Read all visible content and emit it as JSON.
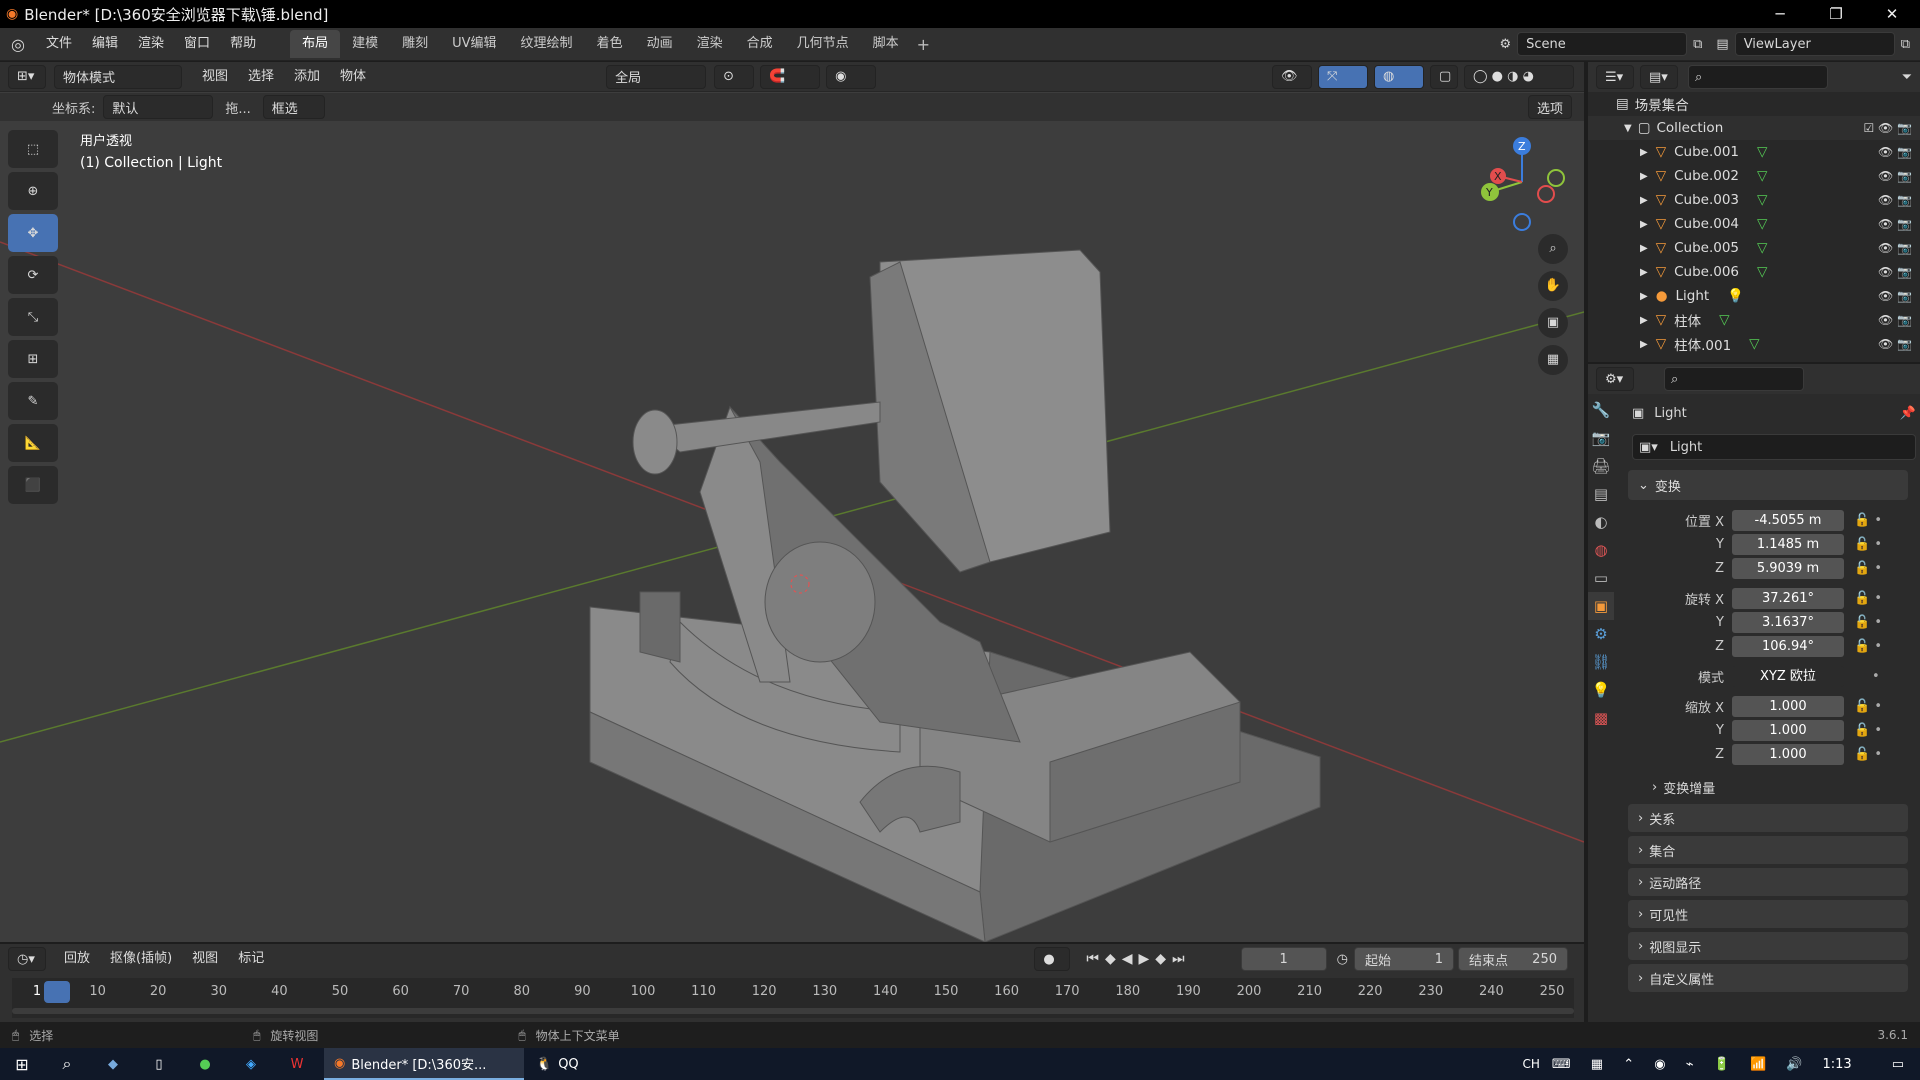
{
  "window": {
    "title": "Blender* [D:\\360安全浏览器下载\\锤.blend]"
  },
  "menu": [
    "文件",
    "编辑",
    "渲染",
    "窗口",
    "帮助"
  ],
  "workspaces": [
    "布局",
    "建模",
    "雕刻",
    "UV编辑",
    "纹理绘制",
    "着色",
    "动画",
    "渲染",
    "合成",
    "几何节点",
    "脚本"
  ],
  "scene": {
    "scene_name": "Scene",
    "view_layer": "ViewLayer"
  },
  "viewport_header": {
    "mode": "物体模式",
    "menus": [
      "视图",
      "选择",
      "添加",
      "物体"
    ],
    "transform_orientation": "全局"
  },
  "viewport_header2": {
    "coord_label": "坐标系:",
    "coord_value": "默认",
    "drag_label": "拖...",
    "select_mode": "框选",
    "options": "选项"
  },
  "viewport": {
    "view_name": "用户透视",
    "context": "(1) Collection | Light",
    "gizmo": {
      "x": "X",
      "y": "Y",
      "z": "Z"
    }
  },
  "outliner": {
    "root": "场景集合",
    "collection": "Collection",
    "items": [
      "Cube.001",
      "Cube.002",
      "Cube.003",
      "Cube.004",
      "Cube.005",
      "Cube.006",
      "Light",
      "柱体",
      "柱体.001"
    ]
  },
  "properties": {
    "object_name": "Light",
    "data_name": "Light",
    "transform_label": "变换",
    "location": {
      "label_x": "位置 X",
      "x": "-4.5055 m",
      "y": "1.1485 m",
      "z": "5.9039 m"
    },
    "rotation": {
      "label_x": "旋转 X",
      "x": "37.261°",
      "y": "3.1637°",
      "z": "106.94°"
    },
    "mode": {
      "label": "模式",
      "value": "XYZ 欧拉"
    },
    "scale": {
      "label_x": "缩放 X",
      "x": "1.000",
      "y": "1.000",
      "z": "1.000"
    },
    "axis_y": "Y",
    "axis_z": "Z",
    "delta": "变换增量",
    "panels": [
      "关系",
      "集合",
      "运动路径",
      "可见性",
      "视图显示",
      "自定义属性"
    ]
  },
  "timeline": {
    "menus": [
      "回放",
      "抠像(插帧)",
      "视图",
      "标记"
    ],
    "current_frame": "1",
    "start_label": "起始",
    "start": "1",
    "end_label": "结束点",
    "end": "250",
    "ticks": [
      "1",
      "10",
      "20",
      "30",
      "40",
      "50",
      "60",
      "70",
      "80",
      "90",
      "100",
      "110",
      "120",
      "130",
      "140",
      "150",
      "160",
      "170",
      "180",
      "190",
      "200",
      "210",
      "220",
      "230",
      "240",
      "250"
    ]
  },
  "status": {
    "select": "选择",
    "rotate": "旋转视图",
    "context_menu": "物体上下文菜单",
    "version": "3.6.1"
  },
  "taskbar": {
    "blender": "Blender* [D:\\360安...",
    "qq": "QQ",
    "lang": "CH",
    "time": "1:13"
  }
}
